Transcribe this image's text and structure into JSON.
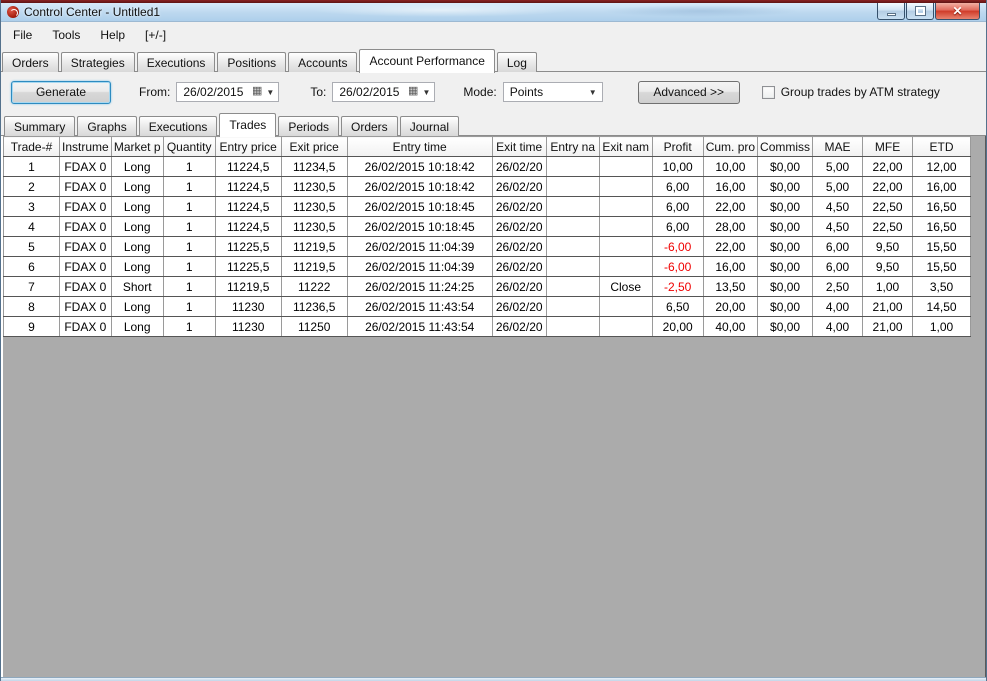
{
  "window": {
    "title": "Control Center - Untitled1",
    "controls": [
      "minimize",
      "maximize",
      "close"
    ]
  },
  "menu": {
    "items": [
      "File",
      "Tools",
      "Help",
      "[+/-]"
    ]
  },
  "main_tabs": {
    "items": [
      "Orders",
      "Strategies",
      "Executions",
      "Positions",
      "Accounts",
      "Account Performance",
      "Log"
    ],
    "active": "Account Performance"
  },
  "toolbar": {
    "generate_label": "Generate",
    "from_label": "From:",
    "from_value": "26/02/2015",
    "to_label": "To:",
    "to_value": "26/02/2015",
    "mode_label": "Mode:",
    "mode_value": "Points",
    "advanced_label": "Advanced >>",
    "group_checkbox_label": "Group trades by ATM strategy",
    "group_checkbox_checked": false
  },
  "sub_tabs": {
    "items": [
      "Summary",
      "Graphs",
      "Executions",
      "Trades",
      "Periods",
      "Orders",
      "Journal"
    ],
    "active": "Trades"
  },
  "table": {
    "columns": [
      "Trade-#",
      "Instrume",
      "Market p",
      "Quantity",
      "Entry price",
      "Exit price",
      "Entry time",
      "Exit time",
      "Entry na",
      "Exit nam",
      "Profit",
      "Cum. pro",
      "Commiss",
      "MAE",
      "MFE",
      "ETD"
    ],
    "rows": [
      [
        "1",
        "FDAX 0",
        "Long",
        "1",
        "11224,5",
        "11234,5",
        "26/02/2015 10:18:42",
        "26/02/20",
        "",
        "",
        "10,00",
        "10,00",
        "$0,00",
        "5,00",
        "22,00",
        "12,00"
      ],
      [
        "2",
        "FDAX 0",
        "Long",
        "1",
        "11224,5",
        "11230,5",
        "26/02/2015 10:18:42",
        "26/02/20",
        "",
        "",
        "6,00",
        "16,00",
        "$0,00",
        "5,00",
        "22,00",
        "16,00"
      ],
      [
        "3",
        "FDAX 0",
        "Long",
        "1",
        "11224,5",
        "11230,5",
        "26/02/2015 10:18:45",
        "26/02/20",
        "",
        "",
        "6,00",
        "22,00",
        "$0,00",
        "4,50",
        "22,50",
        "16,50"
      ],
      [
        "4",
        "FDAX 0",
        "Long",
        "1",
        "11224,5",
        "11230,5",
        "26/02/2015 10:18:45",
        "26/02/20",
        "",
        "",
        "6,00",
        "28,00",
        "$0,00",
        "4,50",
        "22,50",
        "16,50"
      ],
      [
        "5",
        "FDAX 0",
        "Long",
        "1",
        "11225,5",
        "11219,5",
        "26/02/2015 11:04:39",
        "26/02/20",
        "",
        "",
        "-6,00",
        "22,00",
        "$0,00",
        "6,00",
        "9,50",
        "15,50"
      ],
      [
        "6",
        "FDAX 0",
        "Long",
        "1",
        "11225,5",
        "11219,5",
        "26/02/2015 11:04:39",
        "26/02/20",
        "",
        "",
        "-6,00",
        "16,00",
        "$0,00",
        "6,00",
        "9,50",
        "15,50"
      ],
      [
        "7",
        "FDAX 0",
        "Short",
        "1",
        "11219,5",
        "11222",
        "26/02/2015 11:24:25",
        "26/02/20",
        "",
        "Close",
        "-2,50",
        "13,50",
        "$0,00",
        "2,50",
        "1,00",
        "3,50"
      ],
      [
        "8",
        "FDAX 0",
        "Long",
        "1",
        "11230",
        "11236,5",
        "26/02/2015 11:43:54",
        "26/02/20",
        "",
        "",
        "6,50",
        "20,00",
        "$0,00",
        "4,00",
        "21,00",
        "14,50"
      ],
      [
        "9",
        "FDAX 0",
        "Long",
        "1",
        "11230",
        "11250",
        "26/02/2015 11:43:54",
        "26/02/20",
        "",
        "",
        "20,00",
        "40,00",
        "$0,00",
        "4,00",
        "21,00",
        "1,00"
      ]
    ]
  },
  "colors": {
    "negative_value": "#ef0000",
    "titlebar_glass": "#bcd8ef",
    "close_button": "#cf3a28",
    "grid_empty_area": "#ababab"
  }
}
